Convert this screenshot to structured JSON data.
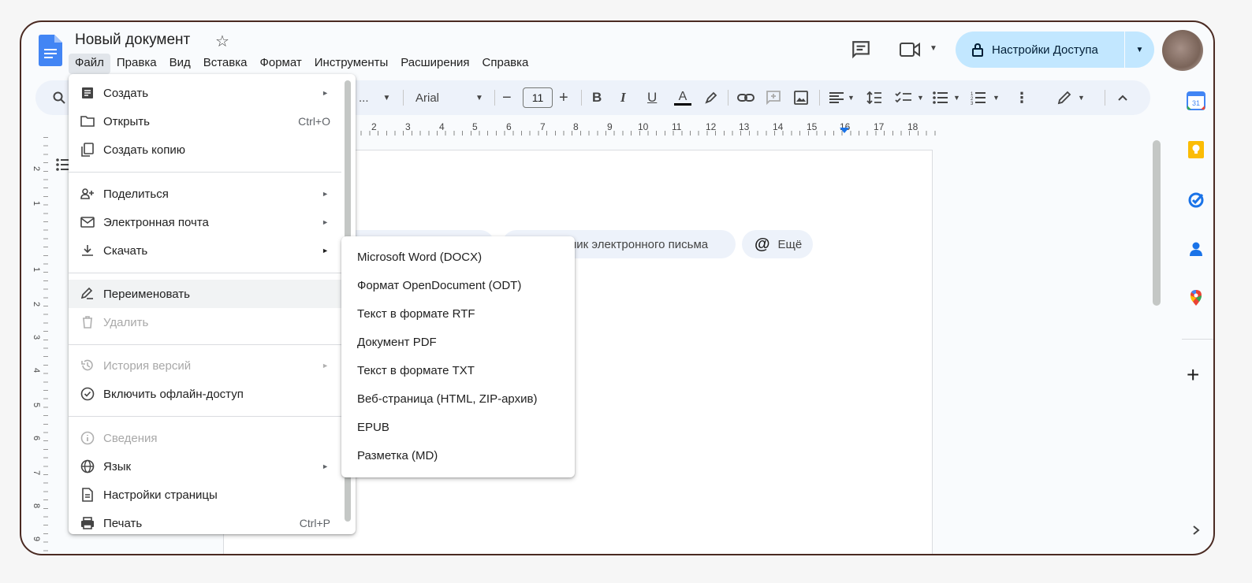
{
  "doc": {
    "title": "Новый документ"
  },
  "menubar": [
    "Файл",
    "Правка",
    "Вид",
    "Вставка",
    "Формат",
    "Инструменты",
    "Расширения",
    "Справка"
  ],
  "share": {
    "label": "Настройки Доступа"
  },
  "toolbar": {
    "font": "Arial",
    "font_size": "11",
    "zoom_placeholder": "..."
  },
  "ruler": {
    "numbers": [
      "2",
      "3",
      "4",
      "5",
      "6",
      "7",
      "8",
      "9",
      "10",
      "11",
      "12",
      "13",
      "14",
      "15",
      "16",
      "17",
      "18"
    ]
  },
  "vruler": {
    "numbers": [
      "2",
      "1",
      "1",
      "2",
      "3",
      "4",
      "5",
      "6",
      "7",
      "8",
      "9"
    ]
  },
  "chips": {
    "email": "ник электронного письма",
    "more": "Ещё"
  },
  "file_menu": {
    "create": "Создать",
    "open": "Открыть",
    "open_shortcut": "Ctrl+O",
    "copy": "Создать копию",
    "share": "Поделиться",
    "email": "Электронная почта",
    "download": "Скачать",
    "rename": "Переименовать",
    "delete": "Удалить",
    "history": "История версий",
    "offline": "Включить офлайн-доступ",
    "details": "Сведения",
    "language": "Язык",
    "page_setup": "Настройки страницы",
    "print": "Печать",
    "print_shortcut": "Ctrl+P"
  },
  "download_menu": [
    "Microsoft Word (DOCX)",
    "Формат OpenDocument (ODT)",
    "Текст в формате RTF",
    "Документ PDF",
    "Текст в формате TXT",
    "Веб-страница (HTML, ZIP-архив)",
    "EPUB",
    "Разметка (MD)"
  ],
  "colors": {
    "accent": "#1a73e8",
    "share_bg": "#c2e7ff",
    "toolbar_bg": "#edf2fa",
    "frame_border": "#4a2a22"
  }
}
